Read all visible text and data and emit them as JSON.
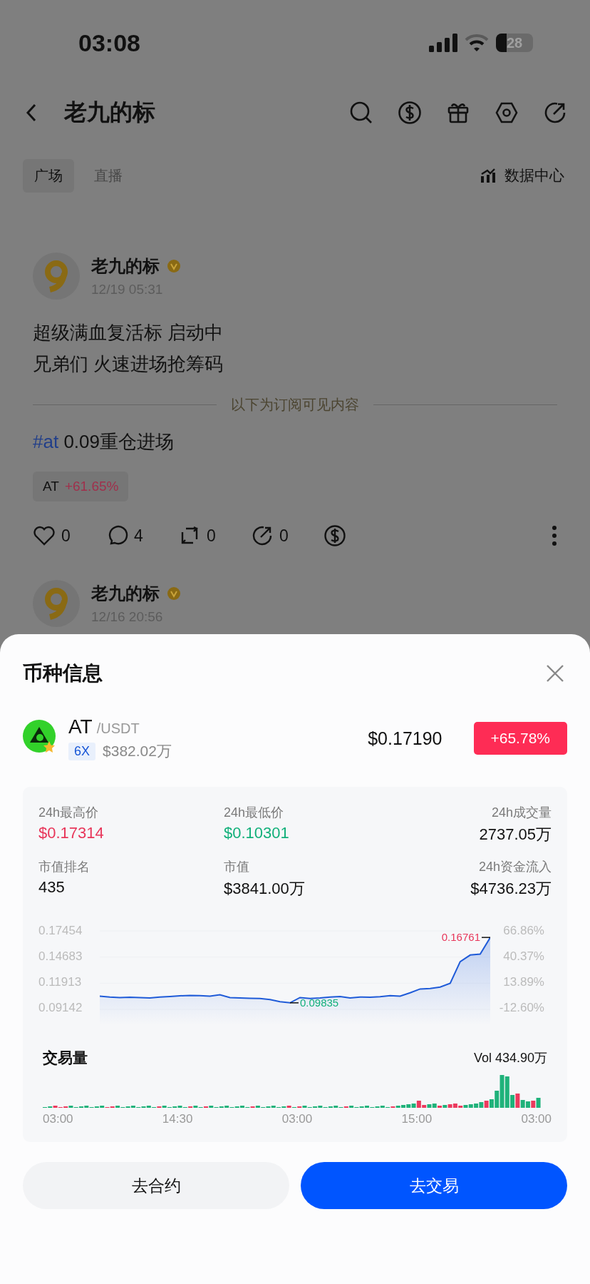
{
  "status_bar": {
    "time": "03:08",
    "battery": "28"
  },
  "header": {
    "title": "老九的标"
  },
  "tabs": [
    {
      "label": "广场",
      "selected": true
    },
    {
      "label": "直播",
      "selected": false
    }
  ],
  "data_center": "数据中心",
  "posts": [
    {
      "author": "老九的标",
      "time": "12/19 05:31",
      "lines": [
        "超级满血复活标 启动中",
        "兄弟们 火速进场抢筹码"
      ],
      "divider": "以下为订阅可见内容",
      "hashtag": "#at",
      "body": "0.09重仓进场",
      "tag": {
        "symbol": "AT",
        "change": "+61.65%"
      },
      "actions": [
        {
          "kind": "like",
          "count": "0"
        },
        {
          "kind": "comment",
          "count": "4"
        },
        {
          "kind": "repost",
          "count": "0"
        },
        {
          "kind": "share",
          "count": "0"
        },
        {
          "kind": "tip"
        }
      ]
    },
    {
      "author": "老九的标",
      "time": "12/16 20:56"
    }
  ],
  "sheet": {
    "title": "币种信息",
    "coin": {
      "symbol": "AT",
      "quote": "/USDT",
      "leverage": "6X",
      "volume": "$382.02万",
      "price": "$0.17190",
      "change": "+65.78%"
    },
    "stats": [
      {
        "label": "24h最高价",
        "value": "$0.17314",
        "color": "#e8365a"
      },
      {
        "label": "24h最低价",
        "value": "$0.10301",
        "color": "#12b07a"
      },
      {
        "label": "24h成交量",
        "value": "2737.05万",
        "color": "#111111"
      },
      {
        "label": "市值排名",
        "value": "435",
        "color": "#111111"
      },
      {
        "label": "市值",
        "value": "$3841.00万",
        "color": "#111111"
      },
      {
        "label": "24h资金流入",
        "value": "$4736.23万",
        "color": "#111111"
      }
    ],
    "price_chart": {
      "percent_labels": [
        "66.86%",
        "40.37%",
        "13.89%",
        "-12.60%"
      ],
      "chart_data": {
        "type": "area",
        "series": [
          {
            "color": "#1f5bd8",
            "values": [
              0.1055,
              0.1045,
              0.104,
              0.1042,
              0.104,
              0.1035,
              0.1045,
              0.105,
              0.1058,
              0.1062,
              0.106,
              0.1055,
              0.1068,
              0.104,
              0.1035,
              0.1032,
              0.103,
              0.1018,
              0.0995,
              0.0984,
              0.104,
              0.103,
              0.1035,
              0.1045,
              0.105,
              0.1035,
              0.1045,
              0.1042,
              0.1048,
              0.106,
              0.1055,
              0.109,
              0.113,
              0.1135,
              0.115,
              0.119,
              0.142,
              0.149,
              0.15,
              0.1676
            ]
          }
        ],
        "ylim": [
          0.09142,
          0.17454
        ],
        "yticks": [
          {
            "value": 0.17454,
            "label": "0.17454"
          },
          {
            "value": 0.14683,
            "label": "0.14683"
          },
          {
            "value": 0.11913,
            "label": "0.11913"
          },
          {
            "value": 0.09142,
            "label": "0.09142"
          }
        ],
        "annotations": [
          "0.16761",
          "0.09835"
        ]
      }
    },
    "volume": {
      "title": "交易量",
      "reading": "Vol 434.90万",
      "time_labels": [
        "03:00",
        "14:30",
        "03:00",
        "15:00",
        "03:00"
      ]
    },
    "buttons": [
      {
        "label": "去合约",
        "kind": "secondary"
      },
      {
        "label": "去交易",
        "kind": "primary"
      }
    ]
  }
}
